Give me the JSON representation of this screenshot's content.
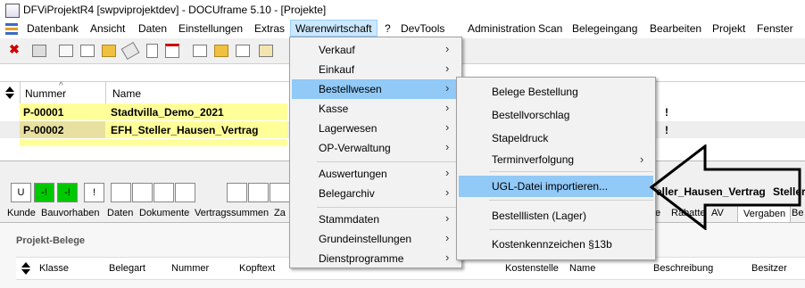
{
  "window": {
    "title": "DFViProjektR4 [swpviprojektdev] - DOCUframe 5.10 - [Projekte]"
  },
  "menubar": {
    "items": [
      "Datenbank",
      "Ansicht",
      "Daten",
      "Einstellungen",
      "Extras",
      "Warenwirtschaft",
      "?",
      "DevTools",
      "Administration",
      "Scan",
      "Belegeingang",
      "Bearbeiten",
      "Projekt",
      "Fenster"
    ]
  },
  "grid": {
    "headers": [
      "Nummer",
      "Name"
    ],
    "rows": [
      {
        "number": "P-00001",
        "name": "Stadtvilla_Demo_2021",
        "flag": "!"
      },
      {
        "number": "P-00002",
        "name": "EFH_Steller_Hausen_Vertrag",
        "flag": "!"
      }
    ]
  },
  "status_boxes": [
    "U",
    "-!",
    "-!",
    "!"
  ],
  "detail_title": "teller_Hausen_Vertrag",
  "detail_title_2": "Steller",
  "tabs": [
    "Kunde",
    "Bauvorhaben",
    "Daten",
    "Dokumente",
    "Vertragssummen",
    "Za"
  ],
  "tabs_right": [
    "te",
    "Rabatte",
    "AV",
    "Vergaben",
    "Be"
  ],
  "section": {
    "title": "Projekt-Belege"
  },
  "belege_headers": [
    "Klasse",
    "Belegart",
    "Nummer",
    "Kopftext",
    "Kostenstelle",
    "Name",
    "Beschreibung",
    "Besitzer"
  ],
  "menu_warenwirtschaft": {
    "items": [
      {
        "label": "Verkauf",
        "submenu": true
      },
      {
        "label": "Einkauf",
        "submenu": true
      },
      {
        "label": "Bestellwesen",
        "submenu": true,
        "highlighted": true
      },
      {
        "label": "Kasse",
        "submenu": true
      },
      {
        "label": "Lagerwesen",
        "submenu": true
      },
      {
        "label": "OP-Verwaltung",
        "submenu": true
      },
      {
        "label": "Auswertungen",
        "submenu": true
      },
      {
        "label": "Belegarchiv",
        "submenu": true
      },
      {
        "label": "Stammdaten",
        "submenu": true
      },
      {
        "label": "Grundeinstellungen",
        "submenu": true
      },
      {
        "label": "Dienstprogramme",
        "submenu": true
      }
    ]
  },
  "menu_bestellwesen": {
    "items": [
      {
        "label": "Belege Bestellung"
      },
      {
        "label": "Bestellvorschlag"
      },
      {
        "label": "Stapeldruck"
      },
      {
        "label": "Terminverfolgung",
        "submenu": true
      },
      {
        "label": "UGL-Datei importieren...",
        "highlighted": true
      },
      {
        "label": "Bestelllisten (Lager)"
      },
      {
        "label": "Kostenkennzeichen §13b"
      }
    ]
  },
  "colors": {
    "row_yellow": "#ffff99",
    "row_selected": "#e8e0a0",
    "menu_highlight": "#91c9f7",
    "status_green": "#00c800"
  }
}
